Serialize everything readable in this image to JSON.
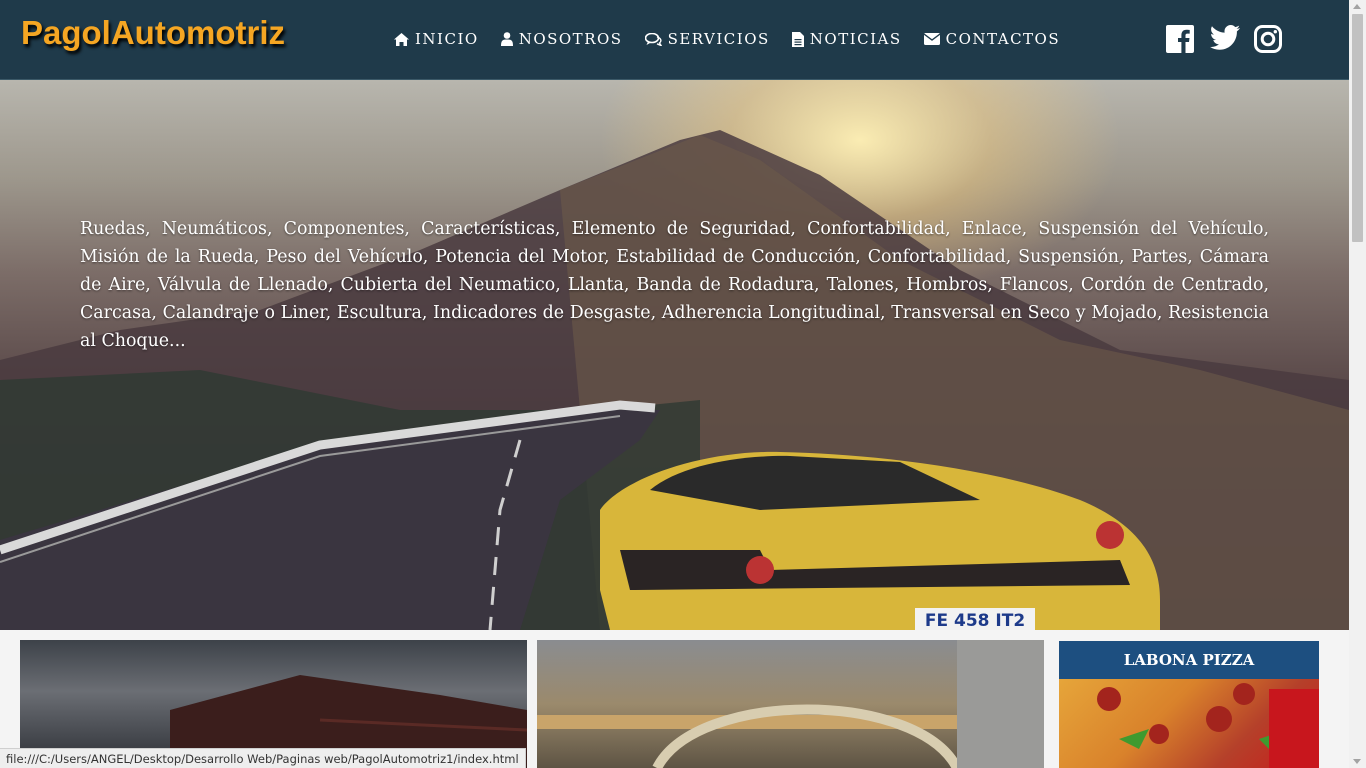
{
  "brand": "PagolAutomotriz",
  "nav": [
    {
      "label": "INICIO",
      "icon": "home-icon"
    },
    {
      "label": "NOSOTROS",
      "icon": "user-icon"
    },
    {
      "label": "SERVICIOS",
      "icon": "comments-icon"
    },
    {
      "label": "NOTICIAS",
      "icon": "document-icon"
    },
    {
      "label": "CONTACTOS",
      "icon": "envelope-icon"
    }
  ],
  "social": [
    "facebook-icon",
    "twitter-icon",
    "instagram-icon"
  ],
  "hero": {
    "text": "Ruedas, Neumáticos, Componentes, Características, Elemento de Seguridad, Confortabilidad, Enlace, Suspensión del Vehículo, Misión de la Rueda, Peso del Vehículo, Potencia del Motor, Estabilidad de Conducción, Confortabilidad, Suspensión, Partes, Cámara de Aire, Válvula de Llenado, Cubierta del Neumatico, Llanta, Banda de Rodadura, Talones, Hombros, Flancos, Cordón de Centrado, Carcasa, Calandraje o Liner, Escultura, Indicadores de Desgaste, Adherencia Longitudinal, Transversal en Seco y Mojado, Resistencia al Choque...",
    "plate": "FE 458 IT2"
  },
  "ad": {
    "title": "LABONA PIZZA"
  },
  "statusbar": "file:///C:/Users/ANGEL/Desktop/Desarrollo Web/Paginas web/PagolAutomotriz1/index.html",
  "colors": {
    "navbar": "#1f3a4a",
    "brand": "#f5a623",
    "ad_header": "#1d4f80"
  }
}
